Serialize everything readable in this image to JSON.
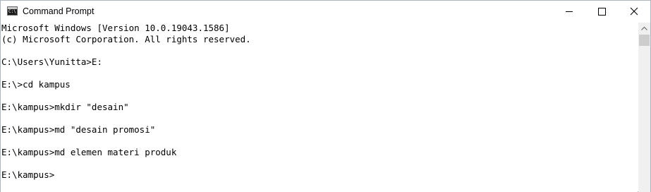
{
  "window": {
    "title": "Command Prompt",
    "app_icon_text": "C:\\",
    "controls": {
      "minimize": "minimize-icon",
      "maximize": "maximize-icon",
      "close": "close-icon"
    }
  },
  "console": {
    "lines": [
      "Microsoft Windows [Version 10.0.19043.1586]",
      "(c) Microsoft Corporation. All rights reserved.",
      "",
      "C:\\Users\\Yunitta>E:",
      "",
      "E:\\>cd kampus",
      "",
      "E:\\kampus>mkdir \"desain\"",
      "",
      "E:\\kampus>md \"desain promosi\"",
      "",
      "E:\\kampus>md elemen materi produk",
      "",
      "E:\\kampus>"
    ]
  },
  "colors": {
    "background": "#ffffff",
    "text": "#000000",
    "scrollbar_track": "#f0f0f0",
    "scrollbar_thumb": "#cdcdcd"
  }
}
